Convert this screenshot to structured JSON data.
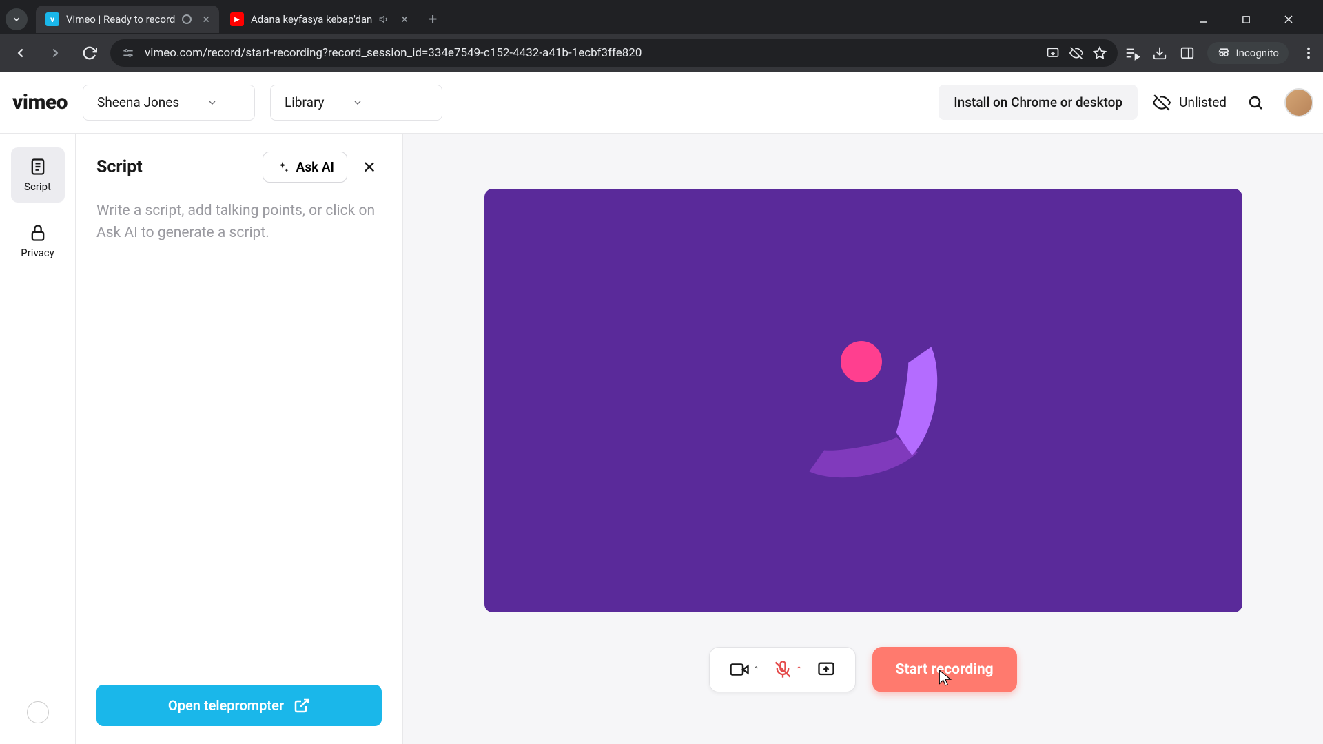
{
  "browser": {
    "tabs": [
      {
        "title": "Vimeo | Ready to record",
        "favicon_bg": "#1ab7ea",
        "favicon_text": "v",
        "active": true
      },
      {
        "title": "Adana keyfasya kebap'dan",
        "favicon_bg": "#ff0000",
        "favicon_glyph": "▶",
        "active": false
      }
    ],
    "url": "vimeo.com/record/start-recording?record_session_id=334e7549-c152-4432-a41b-1ecbf3ffe820",
    "incognito_label": "Incognito"
  },
  "header": {
    "logo": "vimeo",
    "user_select": "Sheena Jones",
    "library_select": "Library",
    "install_label": "Install on Chrome or desktop",
    "visibility_label": "Unlisted"
  },
  "rail": {
    "items": [
      {
        "label": "Script",
        "active": true
      },
      {
        "label": "Privacy",
        "active": false
      }
    ]
  },
  "script_panel": {
    "title": "Script",
    "ask_ai_label": "Ask AI",
    "placeholder": "Write a script, add talking points, or click on Ask AI to generate a script.",
    "teleprompter_label": "Open teleprompter"
  },
  "controls": {
    "start_label": "Start recording"
  }
}
